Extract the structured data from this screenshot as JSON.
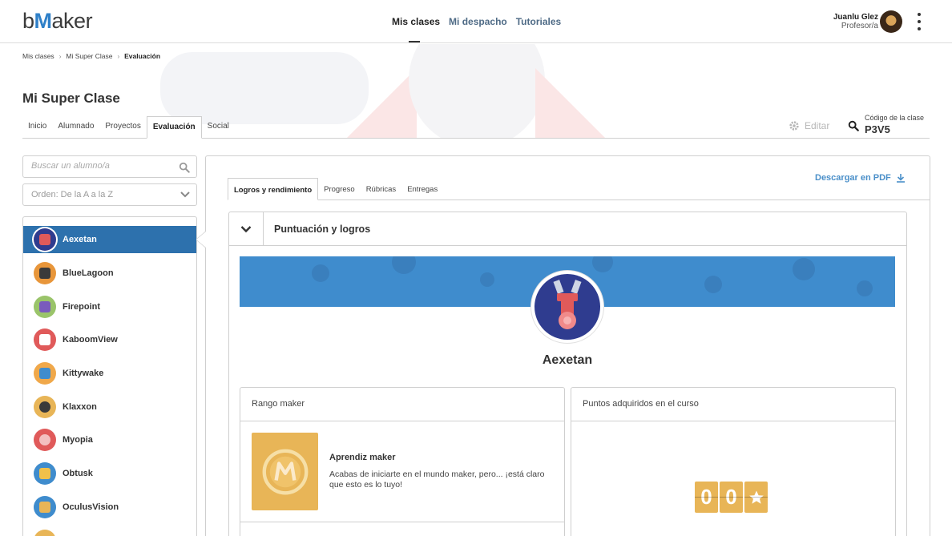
{
  "app": {
    "logo_prefix": "b",
    "logo_m": "M",
    "logo_suffix": "aker"
  },
  "nav": {
    "items": [
      "Mis clases",
      "Mi despacho",
      "Tutoriales"
    ],
    "active": "Mis clases"
  },
  "user": {
    "name": "Juanlu Glez",
    "role": "Profesor/a"
  },
  "breadcrumb": [
    "Mis clases",
    "Mi Super Clase",
    "Evaluación"
  ],
  "class": {
    "title": "Mi Super Clase",
    "tabs": [
      "Inicio",
      "Alumnado",
      "Proyectos",
      "Evaluación",
      "Social"
    ],
    "active_tab": "Evaluación",
    "edit_label": "Editar",
    "code_label": "Código de la clase",
    "code_value": "P3V5"
  },
  "sidebar": {
    "search_placeholder": "Buscar un alumno/a",
    "order_label": "Orden: De la A a la Z",
    "students": [
      {
        "name": "Aexetan",
        "color": "#2f3c8f",
        "accent": "#e05a5a",
        "active": true
      },
      {
        "name": "BlueLagoon",
        "color": "#e8963a",
        "accent": "#3a3a3a"
      },
      {
        "name": "Firepoint",
        "color": "#9ac46a",
        "accent": "#7a5bbd"
      },
      {
        "name": "KaboomView",
        "color": "#e05a5a",
        "accent": "#ffffff"
      },
      {
        "name": "Kittywake",
        "color": "#f0a84a",
        "accent": "#3f8ccd"
      },
      {
        "name": "Klaxxon",
        "color": "#e8b557",
        "accent": "#3a3a3a"
      },
      {
        "name": "Myopia",
        "color": "#e05a5a",
        "accent": "#f3c0c0"
      },
      {
        "name": "Obtusk",
        "color": "#3f8ccd",
        "accent": "#f0c04a"
      },
      {
        "name": "OculusVision",
        "color": "#3f8ccd",
        "accent": "#e8b557"
      }
    ]
  },
  "panel": {
    "pdf_label": "Descargar en PDF",
    "tabs": [
      "Logros y rendimiento",
      "Progreso",
      "Rúbricas",
      "Entregas"
    ],
    "active_tab": "Logros y rendimiento",
    "section_title": "Puntuación y logros",
    "student_name": "Aexetan",
    "rank_card": {
      "title": "Rango maker",
      "rank_name": "Aprendiz maker",
      "rank_desc": "Acabas de iniciarte en el mundo maker, pero... ¡está claro que esto es lo tuyo!"
    },
    "points_card": {
      "title": "Puntos adquiridos en el curso",
      "digits": [
        "0",
        "0"
      ]
    }
  },
  "colors": {
    "brand": "#2f80c8",
    "active_row": "#2d71ad",
    "gold": "#e8b557",
    "banner": "#3f8ccd"
  }
}
